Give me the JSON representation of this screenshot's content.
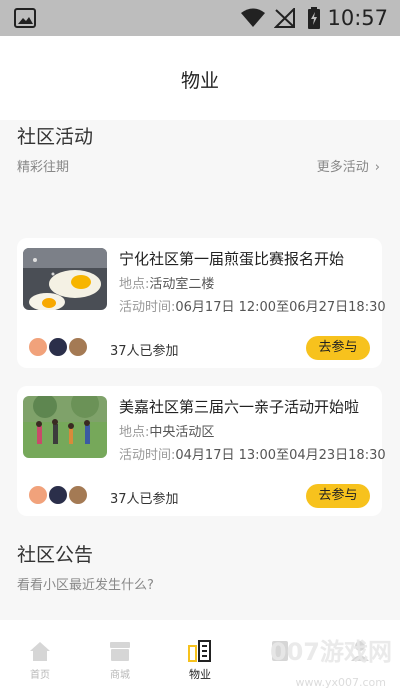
{
  "status_bar": {
    "time": "10:57"
  },
  "app_bar": {
    "title": "物业"
  },
  "activities": {
    "title": "社区活动",
    "subtitle": "精彩往期",
    "more_label": "更多活动",
    "items": [
      {
        "title": "宁化社区第一届煎蛋比赛报名开始",
        "location_label": "地点:",
        "location": "活动室二楼",
        "time_label": "活动时间:",
        "time": "06月17日 12:00至06月27日18:30",
        "joined": "37人已参加",
        "join_label": "去参与"
      },
      {
        "title": "美嘉社区第三届六一亲子活动开始啦",
        "location_label": "地点:",
        "location": "中央活动区",
        "time_label": "活动时间:",
        "time": "04月17日 13:00至04月23日18:30",
        "joined": "37人已参加",
        "join_label": "去参与"
      }
    ]
  },
  "announcements": {
    "title": "社区公告",
    "subtitle": "看看小区最近发生什么?"
  },
  "tabbar": {
    "items": [
      {
        "label": "首页"
      },
      {
        "label": "商城"
      },
      {
        "label": "物业"
      },
      {
        "label": ""
      },
      {
        "label": ""
      }
    ]
  },
  "watermark": {
    "text": "007游戏网",
    "url": "www.yx007.com"
  }
}
